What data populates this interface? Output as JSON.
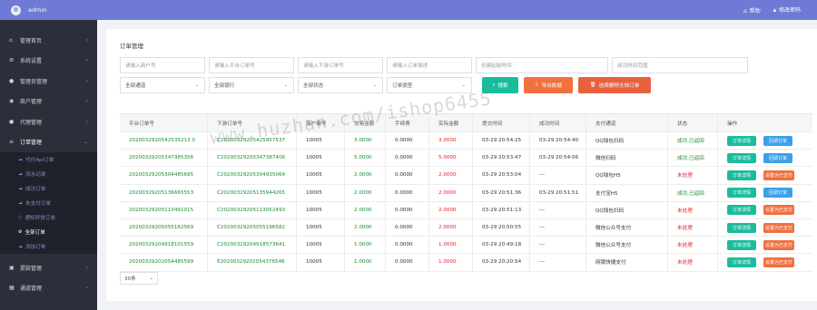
{
  "topbar": {
    "username": "admin",
    "help": "帮助",
    "change_password": "修改密码"
  },
  "sidebar": {
    "items": [
      {
        "label": "管理首页",
        "icon": "home-icon"
      },
      {
        "label": "系统设置",
        "icon": "gear-icon"
      },
      {
        "label": "管理员管理",
        "icon": "user-circle-icon"
      },
      {
        "label": "商户管理",
        "icon": "users-icon"
      },
      {
        "label": "代理管理",
        "icon": "user-circle-icon"
      },
      {
        "label": "订单管理",
        "icon": "list-icon"
      }
    ],
    "submenu": [
      {
        "label": "代付Api订单"
      },
      {
        "label": "流水记录"
      },
      {
        "label": "成功订单"
      },
      {
        "label": "未支付订单"
      },
      {
        "label": "通知异常订单"
      },
      {
        "label": "全部订单"
      },
      {
        "label": "添加订单"
      }
    ],
    "bottom": [
      {
        "label": "提款管理",
        "icon": "bank-icon"
      },
      {
        "label": "通道管理",
        "icon": "grid-icon"
      }
    ]
  },
  "panel": {
    "title": "订单管理"
  },
  "filters": {
    "merchant_no": "请输入商户号",
    "platform_order": "请输入平台订单号",
    "downstream_order": "请输入下游订单号",
    "order_desc": "请输入订单描述",
    "create_time": "创建起始时间",
    "success_time": "成功时间范围",
    "channel": "全部通道",
    "bank": "全部银行",
    "status": "全部状态",
    "order_type": "订单类型"
  },
  "buttons": {
    "search": "搜索",
    "export": "导出数据",
    "delete_invalid": "选择删除无效订单"
  },
  "table": {
    "headers": [
      "平台订单号",
      "下游订单号",
      "商户编号",
      "交易金额",
      "手续费",
      "实际金额",
      "提交时间",
      "成功时间",
      "支付通道",
      "状态",
      "操作"
    ],
    "rows": [
      {
        "platform": "2020032920542535213 0",
        "down": "C20200329205425957537",
        "merchant": "10005",
        "amount": "3.0000",
        "fee": "0.0000",
        "actual": "3.0000",
        "submit": "03-29 20:54:25",
        "success": "03-29 20:54:40",
        "channel": "QQ钱包扫码",
        "status": "成功,已返回",
        "status_type": "ok",
        "act2": "回调订单"
      },
      {
        "platform": "20200329205347985356",
        "down": "C20200329205347387406",
        "merchant": "10005",
        "amount": "5.0000",
        "fee": "0.0000",
        "actual": "5.0000",
        "submit": "03-29 20:53:47",
        "success": "03-29 20:54:06",
        "channel": "微信扫码",
        "status": "成功,已返回",
        "status_type": "ok",
        "act2": "回调订单"
      },
      {
        "platform": "20200329205304485695",
        "down": "C20200329205304935064",
        "merchant": "10005",
        "amount": "2.0000",
        "fee": "0.0000",
        "actual": "2.0000",
        "submit": "03-29 20:53:04",
        "success": "---",
        "channel": "QQ钱包H5",
        "status": "未处理",
        "status_type": "no",
        "act2": "设置为已支付"
      },
      {
        "platform": "20200329205136665553",
        "down": "C20200329205135944265",
        "merchant": "10005",
        "amount": "2.0000",
        "fee": "0.0000",
        "actual": "2.0000",
        "submit": "03-29 20:51:36",
        "success": "03-29 20:51:51",
        "channel": "支付宝H5",
        "status": "成功,已返回",
        "status_type": "ok",
        "act2": "回调订单"
      },
      {
        "platform": "20200329205113491015",
        "down": "C20200329205113052493",
        "merchant": "10005",
        "amount": "2.0000",
        "fee": "0.0000",
        "actual": "2.0000",
        "submit": "03-29 20:51:13",
        "success": "---",
        "channel": "QQ钱包扫码",
        "status": "未处理",
        "status_type": "no",
        "act2": "设置为已支付"
      },
      {
        "platform": "20200329205055162569",
        "down": "C20200329205055196582",
        "merchant": "10005",
        "amount": "2.0000",
        "fee": "0.0000",
        "actual": "2.0000",
        "submit": "03-29 20:50:55",
        "success": "---",
        "channel": "微信公众号支付",
        "status": "未处理",
        "status_type": "no",
        "act2": "设置为已支付"
      },
      {
        "platform": "20200329204918101559",
        "down": "C20200329204918573641",
        "merchant": "10005",
        "amount": "1.0000",
        "fee": "0.0000",
        "actual": "1.0000",
        "submit": "03-29 20:49:18",
        "success": "---",
        "channel": "微信公众号支付",
        "status": "未处理",
        "status_type": "no",
        "act2": "设置为已支付"
      },
      {
        "platform": "20200329202054485599",
        "down": "E20200329202054376546",
        "merchant": "10005",
        "amount": "1.0000",
        "fee": "0.0000",
        "actual": "1.0000",
        "submit": "03-29 20:20:54",
        "success": "---",
        "channel": "网银快捷支付",
        "status": "未处理",
        "status_type": "no",
        "act2": "设置为已支付"
      }
    ],
    "detail_label": "订单详情"
  },
  "pagination": {
    "page_size": "30条"
  },
  "watermark": "www.huzhan.com/ishop6455",
  "colors": {
    "topbar": "#6f7ad4",
    "sidebar": "#2b2f3a",
    "success": "#1abc9c",
    "warning": "#f0703e",
    "info": "#3aa0e8"
  }
}
